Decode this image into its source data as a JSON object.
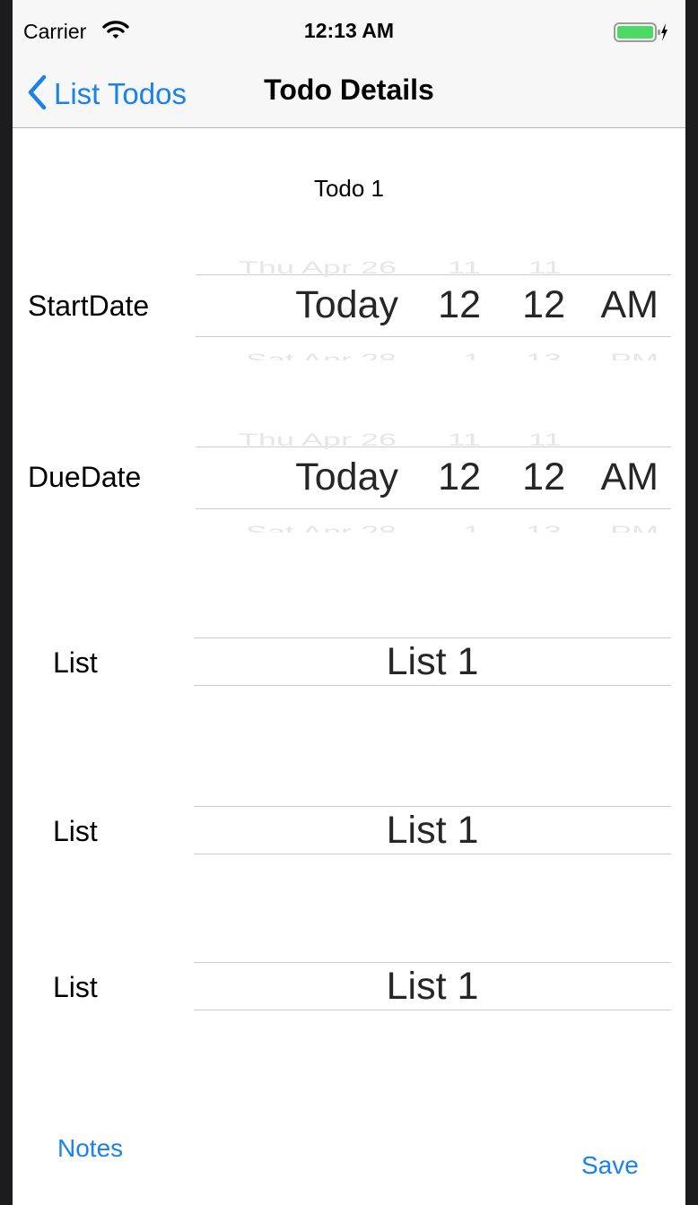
{
  "status_bar": {
    "carrier": "Carrier",
    "time": "12:13 AM"
  },
  "nav": {
    "back_label": "List Todos",
    "title": "Todo Details"
  },
  "todo_name": "Todo 1",
  "start_date": {
    "label": "StartDate",
    "selected": {
      "day": "Today",
      "hour": "12",
      "minute": "12",
      "period": "AM"
    },
    "above": {
      "day": "Thu Apr 26",
      "hour": "11",
      "minute": "11"
    },
    "below": {
      "day": "Sat Apr 28",
      "hour": "1",
      "minute": "13",
      "period": "PM"
    }
  },
  "due_date": {
    "label": "DueDate",
    "selected": {
      "day": "Today",
      "hour": "12",
      "minute": "12",
      "period": "AM"
    },
    "above": {
      "day": "Thu Apr 26",
      "hour": "11",
      "minute": "11"
    },
    "below": {
      "day": "Sat Apr 28",
      "hour": "1",
      "minute": "13",
      "period": "PM"
    }
  },
  "lists": [
    {
      "label": "List",
      "value": "List 1"
    },
    {
      "label": "List",
      "value": "List 1"
    },
    {
      "label": "List",
      "value": "List 1"
    }
  ],
  "buttons": {
    "notes": "Notes",
    "save": "Save"
  },
  "colors": {
    "accent": "#1a82e8",
    "battery": "#4cd964"
  }
}
